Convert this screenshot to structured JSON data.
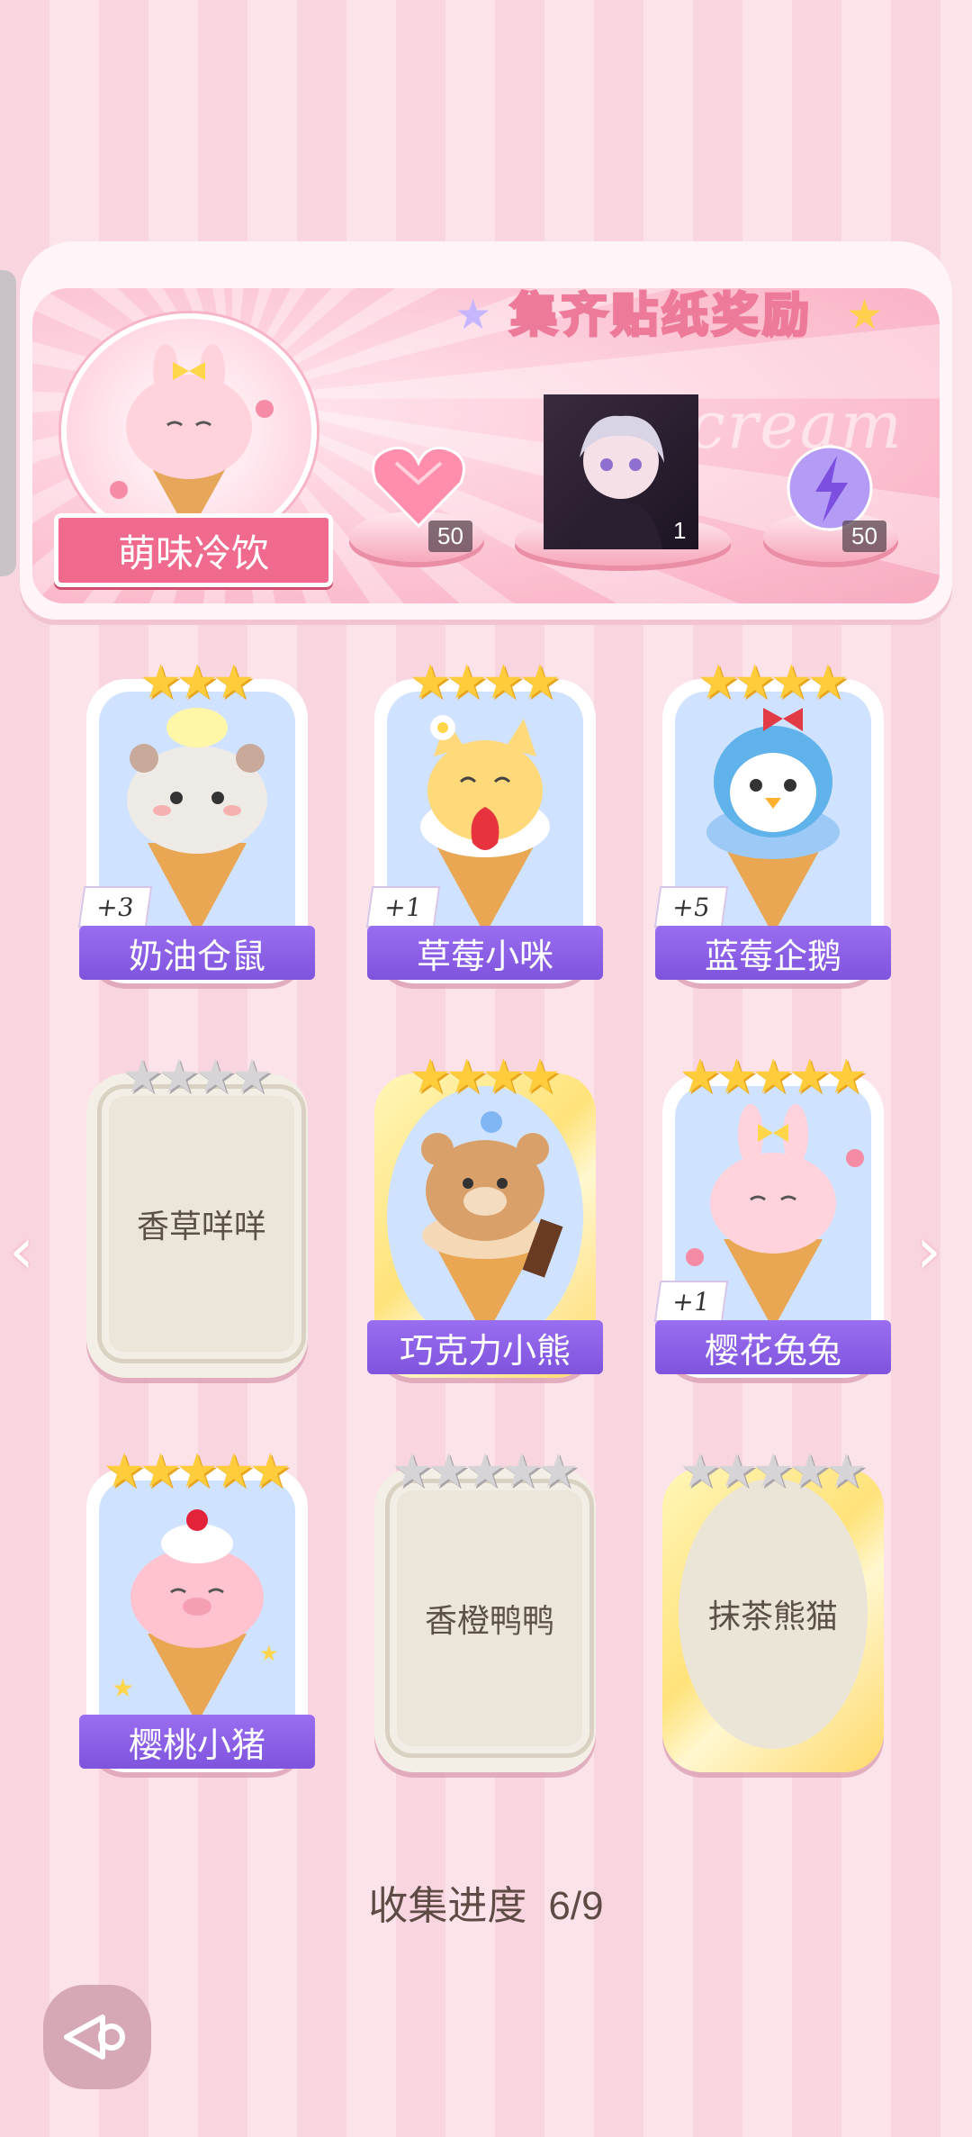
{
  "header": {
    "title": "集齐贴纸奖励",
    "watermark": "ICEcream",
    "featured_name": "萌味冷饮",
    "rewards": [
      {
        "icon": "heart-gem-icon",
        "count": "50"
      },
      {
        "icon": "character-portrait",
        "count": "1"
      },
      {
        "icon": "energy-orb-icon",
        "count": "50"
      }
    ]
  },
  "cards": [
    {
      "name": "奶油仓鼠",
      "stars_filled": 3,
      "stars_total": 3,
      "unlocked": true,
      "badge": "+3",
      "icon": "hamster-icecream-icon"
    },
    {
      "name": "草莓小咪",
      "stars_filled": 4,
      "stars_total": 4,
      "unlocked": true,
      "badge": "+1",
      "icon": "cat-icecream-icon"
    },
    {
      "name": "蓝莓企鹅",
      "stars_filled": 4,
      "stars_total": 4,
      "unlocked": true,
      "badge": "+5",
      "icon": "penguin-icecream-icon"
    },
    {
      "name": "香草咩咩",
      "stars_filled": 0,
      "stars_total": 4,
      "unlocked": false
    },
    {
      "name": "巧克力小熊",
      "stars_filled": 4,
      "stars_total": 4,
      "unlocked": true,
      "icon": "bear-icecream-icon"
    },
    {
      "name": "樱花兔兔",
      "stars_filled": 5,
      "stars_total": 5,
      "unlocked": true,
      "badge": "+1",
      "icon": "bunny-icecream-icon"
    },
    {
      "name": "樱桃小猪",
      "stars_filled": 5,
      "stars_total": 5,
      "unlocked": true,
      "icon": "pig-icecream-icon"
    },
    {
      "name": "香橙鸭鸭",
      "stars_filled": 0,
      "stars_total": 5,
      "unlocked": false
    },
    {
      "name": "抹茶熊猫",
      "stars_filled": 0,
      "stars_total": 5,
      "unlocked": false
    }
  ],
  "progress": {
    "label": "收集进度",
    "value": "6/9"
  },
  "colors": {
    "accent_pink": "#f06a8d",
    "name_bar_purple": "#8a5fe6",
    "star_gold": "#ffcd3b"
  }
}
